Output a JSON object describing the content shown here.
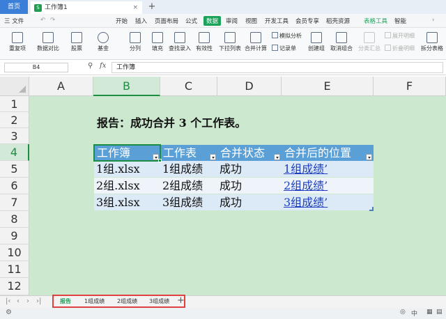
{
  "window": {
    "home_tab": "首页",
    "doc_tab": "工作簿1",
    "doc_logo": "S",
    "close_glyph": "×",
    "add_glyph": "+"
  },
  "menu": {
    "file": "三 文件",
    "items": [
      "开始",
      "插入",
      "页面布局",
      "公式",
      "数据",
      "审阅",
      "视图",
      "开发工具",
      "会员专享",
      "稻壳资源"
    ],
    "active": "数据",
    "table_tools": "表格工具",
    "smart_toolbox": "智能"
  },
  "ribbon": {
    "big": [
      "重复项",
      "数据对比",
      "股票",
      "基金",
      "分列",
      "填充",
      "查找录入",
      "有效性",
      "下拉列表",
      "合并计算",
      "创建组",
      "取消组合",
      "分类汇总",
      "拆分表格"
    ],
    "small": {
      "simulate": "模拟分析",
      "record": "记录单",
      "expand": "展开明细",
      "collapse": "折叠明细"
    }
  },
  "formula_bar": {
    "cell_ref": "B4",
    "fx": "fx",
    "value": "工作簿"
  },
  "columns": [
    "A",
    "B",
    "C",
    "D",
    "E",
    "F"
  ],
  "selected_column": "B",
  "rows": [
    "1",
    "2",
    "3",
    "4",
    "5",
    "6",
    "7",
    "8",
    "9",
    "10",
    "11",
    "12"
  ],
  "selected_row": "4",
  "sheet": {
    "title": "报告：成功合并 3 个工作表。",
    "headers": [
      "工作簿",
      "工作表",
      "合并状态",
      "合并后的位置"
    ],
    "data": [
      [
        "1组.xlsx",
        "1组成绩",
        "成功",
        "1组成绩’"
      ],
      [
        "2组.xlsx",
        "2组成绩",
        "成功",
        "2组成绩’"
      ],
      [
        "3组.xlsx",
        "3组成绩",
        "成功",
        "3组成绩’"
      ]
    ]
  },
  "sheet_tabs": [
    "报告",
    "1组成绩",
    "2组成绩",
    "3组成绩"
  ],
  "active_sheet": "报告",
  "status": {
    "zoom_icon_text": "中"
  },
  "colors": {
    "accent": "#1ba35a",
    "table_header": "#5aa0d6",
    "grid_bg": "#cce8cf",
    "highlight_box": "#e04040"
  }
}
